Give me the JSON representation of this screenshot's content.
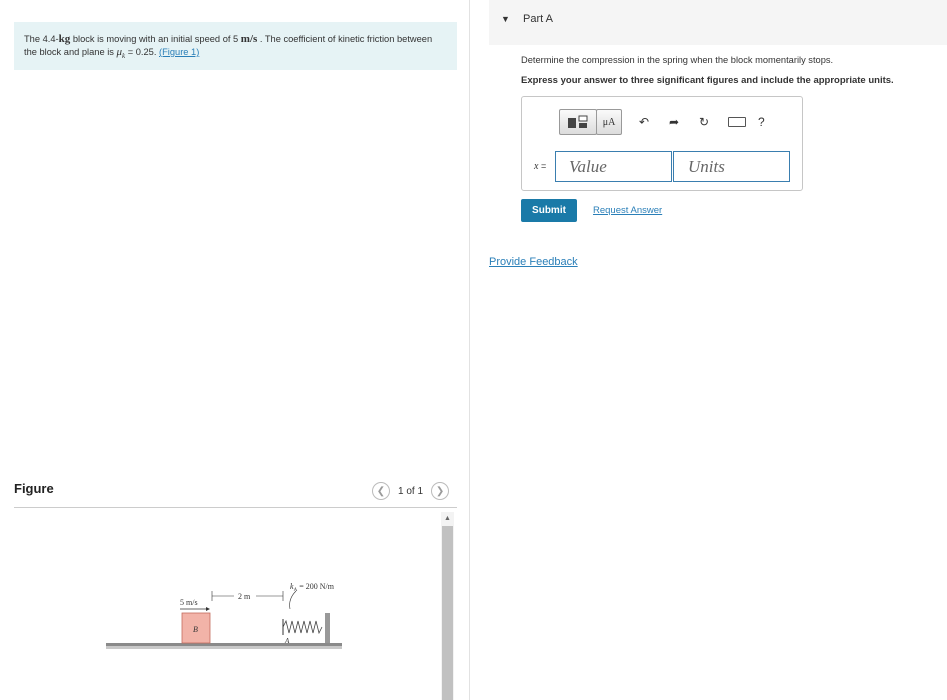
{
  "problem": {
    "t1": "The 4.4-",
    "kg": "kg",
    "t2": " block is moving with an initial speed of 5 ",
    "ms": "m/s",
    "t3": " . The coefficient of kinetic friction between the block and plane is ",
    "mu": "μ",
    "sub": "k",
    "t4": " = 0.25. ",
    "figure_link": "(Figure 1)"
  },
  "figure": {
    "title": "Figure",
    "count": "1 of 1",
    "prev_icon": "chevron-left-icon",
    "next_icon": "chevron-right-icon",
    "labels": {
      "speed": "5 m/s",
      "distance": "2 m",
      "spring_k": "k",
      "spring_sub": "A",
      "spring_val": " = 200 N/m",
      "block": "B",
      "anchor": "A"
    },
    "colors": {
      "block_fill": "#f2b3a8",
      "block_stroke": "#c46b5c",
      "ground": "#8a8a8a"
    }
  },
  "part": {
    "label": "Part A",
    "question": "Determine the compression in the spring when the block momentarily stops.",
    "instruction": "Express your answer to three significant figures and include the appropriate units.",
    "toolbar": {
      "templates_icon": "templates-icon",
      "units_btn": "μA",
      "undo_icon": "undo-icon",
      "redo_icon": "redo-icon",
      "reset_icon": "reset-icon",
      "keyboard_icon": "keyboard-icon",
      "help": "?"
    },
    "variable": "x",
    "equals": " =",
    "value_placeholder": "Value",
    "units_placeholder": "Units",
    "submit": "Submit",
    "request_answer": "Request Answer"
  },
  "feedback": "Provide Feedback",
  "accent": "#1a7aa8",
  "link_color": "#2a7fb8"
}
